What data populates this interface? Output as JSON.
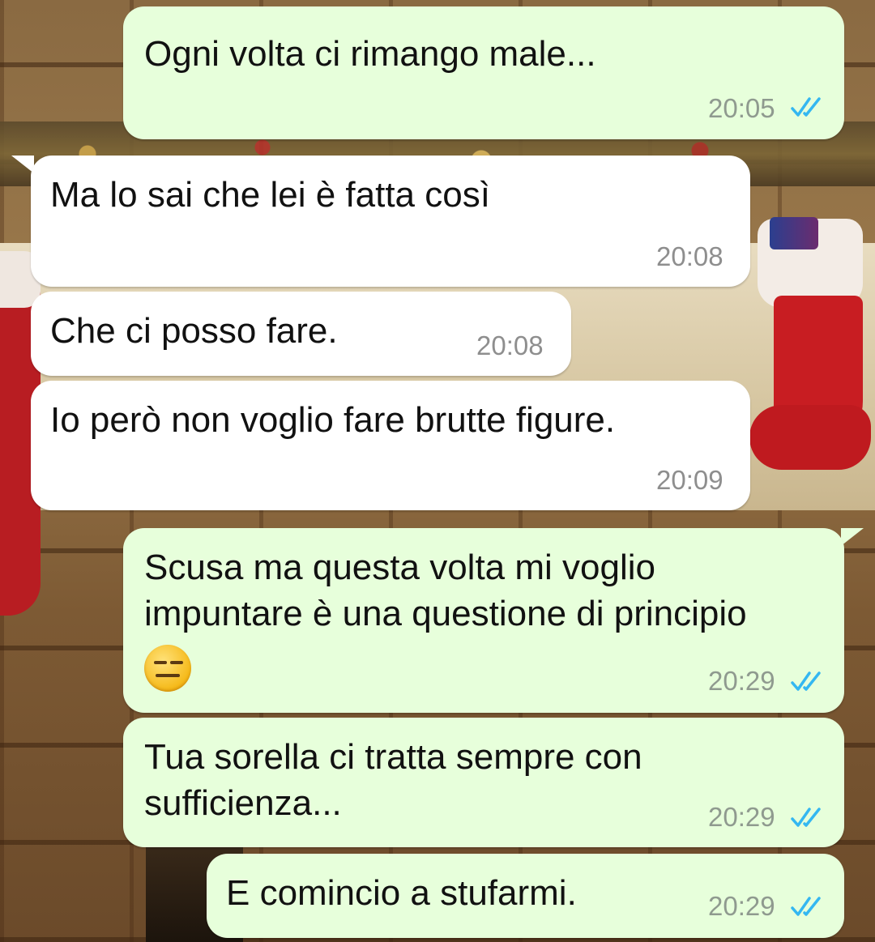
{
  "colors": {
    "outgoing_bubble": "#e7ffdb",
    "incoming_bubble": "#ffffff",
    "read_ticks": "#34b7f1",
    "timestamp": "#8f9a8f"
  },
  "messages": [
    {
      "direction": "out",
      "text_lines": [
        "Ogni volta ci rimango male..."
      ],
      "time": "20:05",
      "status": "read-double-check-icon"
    },
    {
      "direction": "in",
      "text_lines": [
        "Ma lo sai che lei è fatta così"
      ],
      "time": "20:08"
    },
    {
      "direction": "in",
      "text_lines": [
        "Che ci posso fare."
      ],
      "time": "20:08"
    },
    {
      "direction": "in",
      "text_lines": [
        "Io però non voglio fare brutte figure."
      ],
      "time": "20:09"
    },
    {
      "direction": "out",
      "text_lines": [
        "Scusa ma questa volta mi voglio",
        "impuntare è una questione di principio"
      ],
      "emoji": "expressionless-face-icon",
      "time": "20:29",
      "status": "read-double-check-icon"
    },
    {
      "direction": "out",
      "text_lines": [
        "Tua sorella ci tratta sempre con",
        "sufficienza..."
      ],
      "time": "20:29",
      "status": "read-double-check-icon"
    },
    {
      "direction": "out",
      "text_lines": [
        "E comincio a stufarmi."
      ],
      "time": "20:29",
      "status": "read-double-check-icon"
    }
  ]
}
